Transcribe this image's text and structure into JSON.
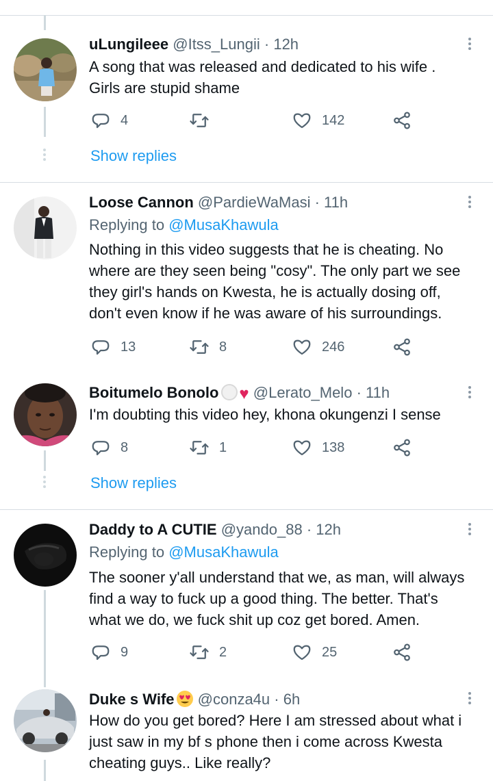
{
  "tweets": [
    {
      "name": "uLungileee",
      "handle": "@Itss_Lungii",
      "time": "· 12h",
      "replying_to": null,
      "text_lines": [
        "A song that was released and dedicated to his wife .",
        "Girls are stupid shame"
      ],
      "replies": "4",
      "retweets": "",
      "likes": "142",
      "show_replies": "Show replies"
    },
    {
      "name": "Loose Cannon",
      "handle": "@PardieWaMasi",
      "time": "· 11h",
      "replying_to": {
        "label": "Replying to",
        "mention": "@MusaKhawula"
      },
      "text_lines": [
        "Nothing in this video suggests that he is cheating. No",
        "where are they seen being \"cosy\". The only part we see",
        "they girl's hands on Kwesta, he is actually dosing off,",
        "don't even know if he was aware of his surroundings."
      ],
      "replies": "13",
      "retweets": "8",
      "likes": "246"
    },
    {
      "name": "Boitumelo Bonolo",
      "handle": "@Lerato_Melo",
      "time": "· 11h",
      "replying_to": null,
      "text_lines": [
        "I'm doubting this video hey, khona okungenzi I sense"
      ],
      "replies": "8",
      "retweets": "1",
      "likes": "138",
      "show_replies": "Show replies"
    },
    {
      "name": "Daddy to A CUTIE",
      "handle": "@yando_88",
      "time": "· 12h",
      "replying_to": {
        "label": "Replying to",
        "mention": "@MusaKhawula"
      },
      "text_lines": [
        "The sooner y'all understand that we, as man, will always",
        "find a way to fuck up a good thing. The better. That's",
        "what we do, we fuck shit up coz get bored. Amen."
      ],
      "replies": "9",
      "retweets": "2",
      "likes": "25"
    },
    {
      "name": "Duke s Wife",
      "handle": "@conza4u",
      "time": "· 6h",
      "replying_to": null,
      "text_lines": [
        "How do you get bored? Here I am stressed about what i",
        "just saw in my bf s phone then i come across Kwesta",
        "cheating guys.. Like really?"
      ]
    }
  ],
  "colors": {
    "accent": "#1d9bf0",
    "secondary_text": "#536471",
    "divider": "#d7dde2",
    "thread_line": "#cfd9de"
  },
  "icons": [
    "reply-icon",
    "retweet-icon",
    "like-icon",
    "share-icon",
    "more-icon"
  ]
}
